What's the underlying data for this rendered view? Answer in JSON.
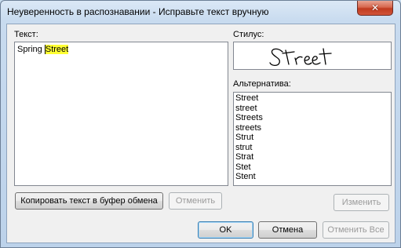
{
  "window": {
    "title": "Неуверенность в распознавании - Исправьте текст вручную",
    "close_glyph": "✕"
  },
  "text_section": {
    "label": "Текст:",
    "plain": "Spring ",
    "highlighted": "Street"
  },
  "stylus_section": {
    "label": "Стилус:",
    "ink": "Street"
  },
  "alternatives_section": {
    "label": "Альтернатива:",
    "items": [
      "Street",
      "street",
      "Streets",
      "streets",
      "Strut",
      "strut",
      "Strat",
      "Stet",
      "Stent"
    ]
  },
  "buttons": {
    "copy": "Копировать текст в буфер обмена",
    "undo": "Отменить",
    "change": "Изменить",
    "ok": "OK",
    "cancel": "Отмена",
    "cancel_all": "Отменить Все"
  },
  "colors": {
    "highlight": "#ffff33",
    "close_button": "#c8452b"
  }
}
